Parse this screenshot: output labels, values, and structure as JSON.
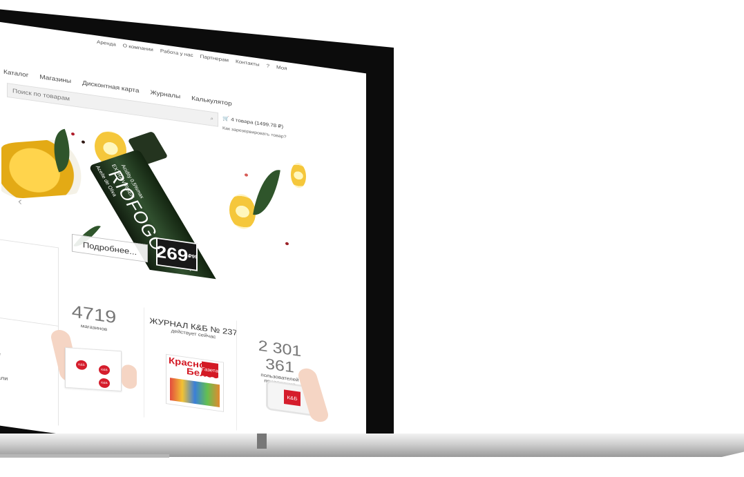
{
  "topLinks": [
    "Аренда",
    "О компании",
    "Работа у нас",
    "Партнерам",
    "Контакты",
    "?",
    "Моя"
  ],
  "nav": [
    "Каталог",
    "Магазины",
    "Дисконтная карта",
    "Журналы",
    "Калькулятор"
  ],
  "search": {
    "placeholder": "Поиск по товарам"
  },
  "cart": {
    "label": "4 товара (1499.78 ₽)",
    "reserve": "Как зарезервировать товар?"
  },
  "banner": {
    "brand": "RIOFOGO",
    "bottleText1": "Aceite de Oliva",
    "bottleText2": "EXTRA VIRGEN",
    "bottleText3": "Acidity 0,5%max",
    "volume": "1/2 L",
    "more": "Подробнее...",
    "price": "269",
    "currency": "₽",
    "kopeks": "99"
  },
  "stats": [
    {
      "number": "4719",
      "label": "магазинов"
    },
    {
      "title": "ЖУРНАЛ К&Б № 237",
      "label": "действует сейчас"
    },
    {
      "number": "2 301 361",
      "label": "пользователей приложения"
    }
  ],
  "sidebar": [
    "е",
    "али"
  ],
  "logo": "К&Б",
  "magazine": {
    "line1": "Красное",
    "line2": "Белое",
    "badge": "Газета"
  },
  "colors": {
    "brandRed": "#d51d2c",
    "screenBg": "#ffffff",
    "laptopFrame": "#0c0c0c"
  }
}
